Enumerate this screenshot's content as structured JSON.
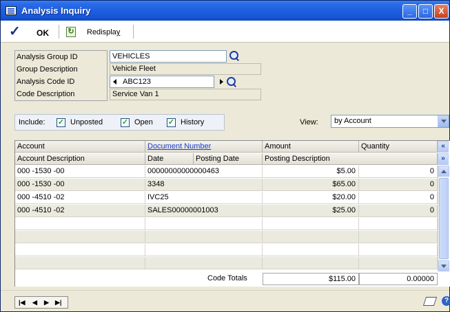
{
  "window": {
    "title": "Analysis Inquiry",
    "controls": [
      "_",
      "□",
      "X"
    ]
  },
  "toolbar": {
    "ok_label": "OK",
    "redisplay_label_prefix": "Redispla",
    "redisplay_label_accel": "y"
  },
  "header": {
    "analysis_group_id_label": "Analysis Group ID",
    "analysis_group_id_value": "VEHICLES",
    "group_description_label": "Group Description",
    "group_description_value": "Vehicle Fleet",
    "analysis_code_id_label": "Analysis Code ID",
    "analysis_code_id_value": "ABC123",
    "code_description_label": "Code Description",
    "code_description_value": "Service Van 1"
  },
  "include": {
    "label": "Include:",
    "options": [
      {
        "label": "Unposted",
        "checked": true
      },
      {
        "label": "Open",
        "checked": true
      },
      {
        "label": "History",
        "checked": true
      }
    ]
  },
  "view": {
    "label": "View:",
    "selected": "by Account"
  },
  "grid": {
    "headers_row1": [
      "Account",
      "Document Number",
      "Amount",
      "Quantity"
    ],
    "headers_row2": [
      "Account Description",
      "Date",
      "Posting Date",
      "Posting Description"
    ],
    "rows": [
      {
        "account": "000 -1530 -00",
        "document": "00000000000000463",
        "amount": "$5.00",
        "quantity": "0"
      },
      {
        "account": "000 -1530 -00",
        "document": "3348",
        "amount": "$65.00",
        "quantity": "0"
      },
      {
        "account": "000 -4510 -02",
        "document": "IVC25",
        "amount": "$20.00",
        "quantity": "0"
      },
      {
        "account": "000 -4510 -02",
        "document": "SALES00000001003",
        "amount": "$25.00",
        "quantity": "0"
      }
    ],
    "empty_rows": 5,
    "totals_label": "Code Totals",
    "total_amount": "$115.00",
    "total_quantity": "0.00000"
  },
  "colors": {
    "title_bar": "#1e5fe0",
    "window_bg": "#ece9d8",
    "link": "#1b3fcf",
    "check": "#21a121"
  }
}
